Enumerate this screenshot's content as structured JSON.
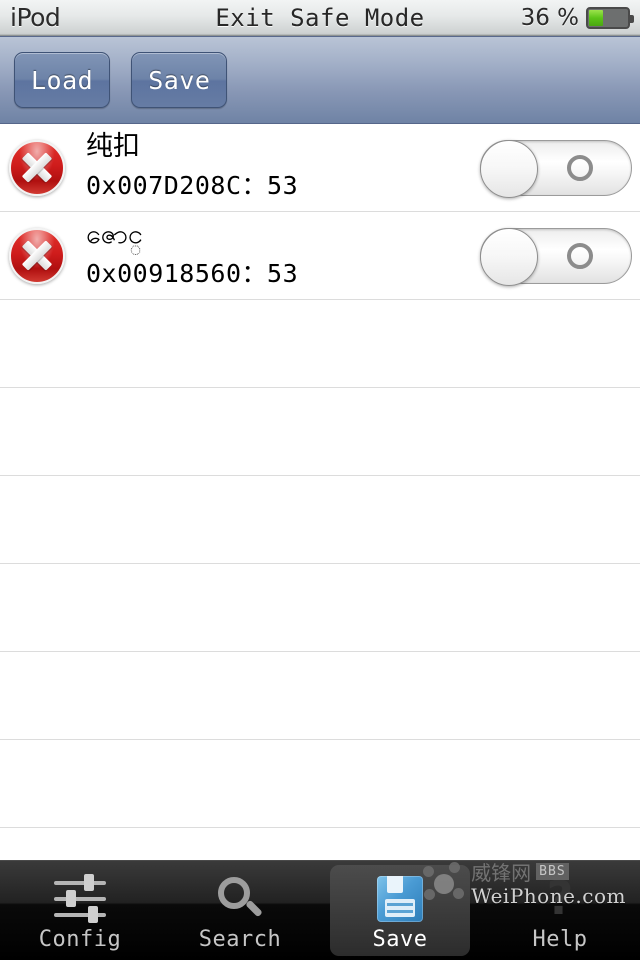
{
  "status_bar": {
    "carrier": "iPod",
    "title": "Exit Safe Mode",
    "battery_percent": "36 %",
    "battery_level": 36,
    "battery_fill_color": "#5cc418"
  },
  "toolbar": {
    "load_label": "Load",
    "save_label": "Save"
  },
  "list": {
    "rows": [
      {
        "title": "纯扣",
        "subtitle": "0x007D208C：53",
        "delete_icon": "delete-circle-icon",
        "switch_state": "off"
      },
      {
        "title": "ဇောင္",
        "subtitle": "0x00918560：53",
        "delete_icon": "delete-circle-icon",
        "switch_state": "off"
      }
    ],
    "empty_row_count": 7
  },
  "tab_bar": {
    "tabs": [
      {
        "label": "Config",
        "icon": "sliders-icon",
        "selected": false
      },
      {
        "label": "Search",
        "icon": "magnifier-icon",
        "selected": false
      },
      {
        "label": "Save",
        "icon": "floppy-disk-icon",
        "selected": true
      },
      {
        "label": "Help",
        "icon": "question-mark-icon",
        "selected": false
      }
    ]
  },
  "watermark": {
    "logo": "weiphone-logo-icon",
    "cn_text": "威锋网",
    "badge": "BBS",
    "en_text": "WeiPhone.com"
  },
  "colors": {
    "toolbar_top": "#b9c4d6",
    "toolbar_bottom": "#6f83a5",
    "button_face": "#6d83a8",
    "delete_red": "#cf1c1c",
    "tabbar_bg": "#000000",
    "separator": "#dcdcdc"
  }
}
